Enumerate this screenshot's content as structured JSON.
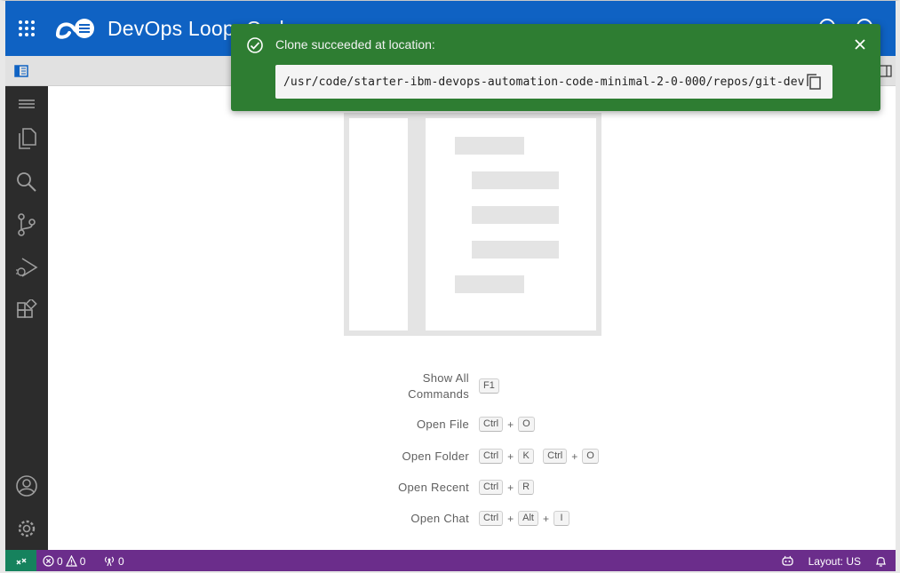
{
  "header": {
    "brand_title": "DevOps Loop: Code",
    "icons": [
      "apps-grid-icon",
      "devops-loop-logo",
      "help-icon",
      "user-icon"
    ],
    "accent_color": "#0f62c3"
  },
  "notification": {
    "message": "Clone succeeded at location:",
    "path": "/usr/code/starter-ibm-devops-automation-code-minimal-2-0-000/repos/git-dev",
    "color": "#2e7d32",
    "icons": [
      "success-check-icon",
      "close-icon",
      "copy-icon"
    ]
  },
  "activity_bar": {
    "items": [
      {
        "name": "menu-icon"
      },
      {
        "name": "explorer-icon"
      },
      {
        "name": "search-icon"
      },
      {
        "name": "source-control-icon"
      },
      {
        "name": "run-debug-icon"
      },
      {
        "name": "extensions-icon"
      },
      {
        "name": "accounts-icon"
      },
      {
        "name": "manage-gear-icon"
      }
    ]
  },
  "shortcuts": [
    {
      "label": "Show All Commands",
      "keys": [
        [
          "F1"
        ]
      ]
    },
    {
      "label": "Open File",
      "keys": [
        [
          "Ctrl",
          "O"
        ]
      ]
    },
    {
      "label": "Open Folder",
      "keys": [
        [
          "Ctrl",
          "K"
        ],
        [
          "Ctrl",
          "O"
        ]
      ]
    },
    {
      "label": "Open Recent",
      "keys": [
        [
          "Ctrl",
          "R"
        ]
      ]
    },
    {
      "label": "Open Chat",
      "keys": [
        [
          "Ctrl",
          "Alt",
          "I"
        ]
      ]
    }
  ],
  "status_bar": {
    "errors": "0",
    "warnings": "0",
    "ports": "0",
    "layout": "Layout: US",
    "color": "#6b2d8b",
    "remote_color": "#16825d"
  }
}
